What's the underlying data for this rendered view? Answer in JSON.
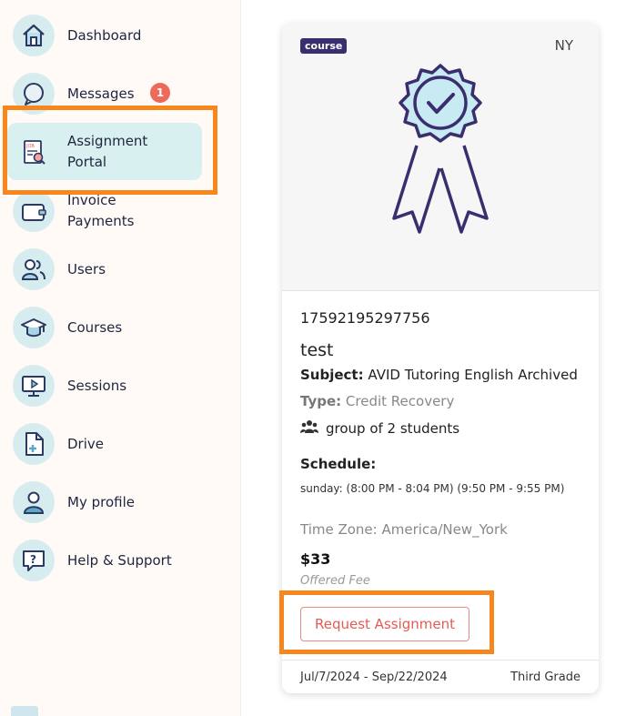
{
  "sidebar": {
    "items": [
      {
        "label": "Dashboard",
        "icon": "home-icon"
      },
      {
        "label": "Messages",
        "icon": "chat-icon",
        "badge": "1"
      },
      {
        "label_line1": "Assignment",
        "label_line2": "Portal",
        "icon": "assignment-document-icon",
        "active": true
      },
      {
        "label_line1": "Invoice",
        "label_line2": "Payments",
        "icon": "wallet-icon"
      },
      {
        "label": "Users",
        "icon": "users-icon"
      },
      {
        "label": "Courses",
        "icon": "graduation-cap-icon"
      },
      {
        "label": "Sessions",
        "icon": "monitor-play-icon"
      },
      {
        "label": "Drive",
        "icon": "file-add-icon"
      },
      {
        "label": "My profile",
        "icon": "person-icon"
      },
      {
        "label": "Help & Support",
        "icon": "help-question-icon"
      }
    ]
  },
  "card": {
    "tag": "course",
    "state": "NY",
    "image_icon": "certificate-badge-icon",
    "id": "17592195297756",
    "title": "test",
    "subject_label": "Subject:",
    "subject_value": "AVID Tutoring English Archived",
    "type_label": "Type:",
    "type_value": "Credit Recovery",
    "group_icon": "users-group-icon",
    "group_text": "group of 2 students",
    "schedule_label": "Schedule:",
    "schedule_text": "sunday: (8:00 PM - 8:04 PM) (9:50 PM - 9:55 PM)",
    "timezone": "Time Zone: America/New_York",
    "price": "$33",
    "fee_label": "Offered Fee",
    "request_button": "Request Assignment",
    "date_range": "Jul/7/2024 - Sep/22/2024",
    "grade": "Third Grade"
  },
  "colors": {
    "accent_orange": "#f7861c",
    "navy": "#3a2e6e",
    "badge_red": "#ee6a5a",
    "button_red": "#e55b52",
    "icon_bg": "#d6ecef"
  }
}
